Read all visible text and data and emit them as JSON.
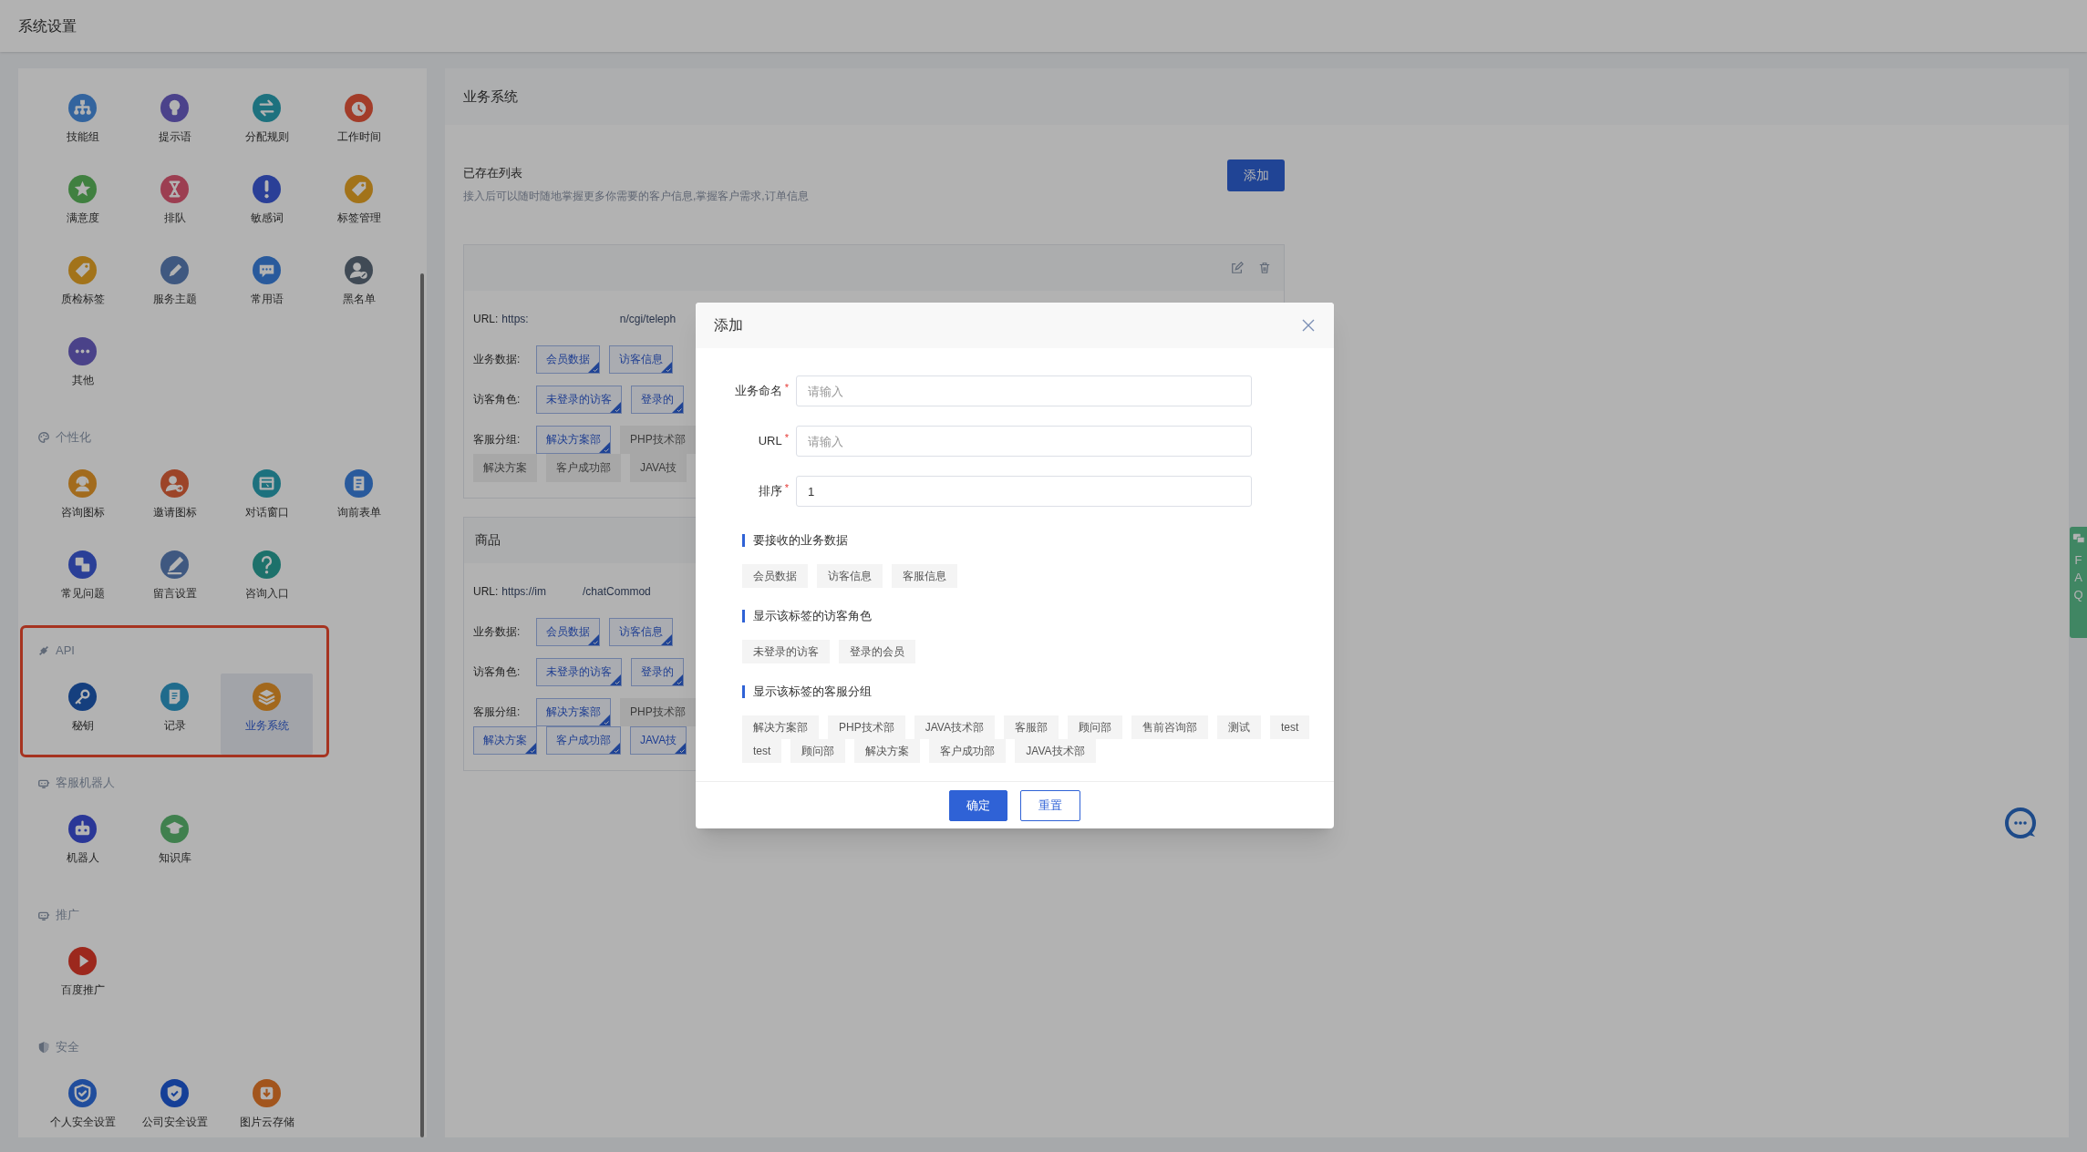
{
  "page_title": "系统设置",
  "settings_panel": {
    "sections": [
      {
        "items": [
          {
            "label": "技能组",
            "selected": false
          },
          {
            "label": "提示语",
            "selected": false
          },
          {
            "label": "分配规则",
            "selected": false
          },
          {
            "label": "工作时间",
            "selected": false
          },
          {
            "label": "满意度",
            "selected": false
          },
          {
            "label": "排队",
            "selected": false
          },
          {
            "label": "敏感词",
            "selected": false
          },
          {
            "label": "标签管理",
            "selected": false
          },
          {
            "label": "质检标签",
            "selected": false
          },
          {
            "label": "服务主题",
            "selected": false
          },
          {
            "label": "常用语",
            "selected": false
          },
          {
            "label": "黑名单",
            "selected": false
          },
          {
            "label": "其他",
            "selected": false
          }
        ]
      },
      {
        "title": "个性化",
        "items": [
          {
            "label": "咨询图标",
            "selected": false
          },
          {
            "label": "邀请图标",
            "selected": false
          },
          {
            "label": "对话窗口",
            "selected": false
          },
          {
            "label": "询前表单",
            "selected": false
          },
          {
            "label": "常见问题",
            "selected": false
          },
          {
            "label": "留言设置",
            "selected": false
          },
          {
            "label": "咨询入口",
            "selected": false
          }
        ]
      },
      {
        "title": "API",
        "highlighted": true,
        "items": [
          {
            "label": "秘钥",
            "selected": false
          },
          {
            "label": "记录",
            "selected": false
          },
          {
            "label": "业务系统",
            "selected": true
          }
        ]
      },
      {
        "title": "客服机器人",
        "items": [
          {
            "label": "机器人",
            "selected": false
          },
          {
            "label": "知识库",
            "selected": false
          }
        ]
      },
      {
        "title": "推广",
        "items": [
          {
            "label": "百度推广",
            "selected": false
          }
        ]
      },
      {
        "title": "安全",
        "items": [
          {
            "label": "个人安全设置",
            "selected": false
          },
          {
            "label": "公司安全设置",
            "selected": false
          },
          {
            "label": "图片云存储",
            "selected": false
          }
        ]
      }
    ]
  },
  "business_panel": {
    "title": "业务系统",
    "list_title": "已存在列表",
    "list_hint": "接入后可以随时随地掌握更多你需要的客户信息,掌握客户需求,订单信息",
    "add_button": "添加",
    "cards": [
      {
        "url_label": "URL:",
        "url_start": "https:",
        "url_end": "n/cgi/teleph",
        "rows": [
          {
            "label": "业务数据:",
            "tags": [
              {
                "text": "会员数据",
                "selected": true
              },
              {
                "text": "访客信息",
                "selected": true
              }
            ]
          },
          {
            "label": "访客角色:",
            "tags": [
              {
                "text": "未登录的访客",
                "selected": true
              },
              {
                "text": "登录的",
                "selected": true
              }
            ]
          },
          {
            "label": "客服分组:",
            "tags": [
              {
                "text": "解决方案部",
                "selected": true
              },
              {
                "text": "PHP技术部",
                "selected": false
              },
              {
                "text": "解决方案",
                "selected": false
              },
              {
                "text": "客户成功部",
                "selected": false
              },
              {
                "text": "JAVA技",
                "selected": false
              }
            ]
          }
        ]
      },
      {
        "title": "商品",
        "url_label": "URL:",
        "url_start": "https://im",
        "url_end": "/chatCommod",
        "rows": [
          {
            "label": "业务数据:",
            "tags": [
              {
                "text": "会员数据",
                "selected": true
              },
              {
                "text": "访客信息",
                "selected": true
              }
            ]
          },
          {
            "label": "访客角色:",
            "tags": [
              {
                "text": "未登录的访客",
                "selected": true
              },
              {
                "text": "登录的",
                "selected": true
              }
            ]
          },
          {
            "label": "客服分组:",
            "tags": [
              {
                "text": "解决方案部",
                "selected": true
              },
              {
                "text": "PHP技术部",
                "selected": false
              },
              {
                "text": "解决方案",
                "selected": true
              },
              {
                "text": "客户成功部",
                "selected": true
              },
              {
                "text": "JAVA技",
                "selected": true
              }
            ]
          }
        ]
      }
    ]
  },
  "modal": {
    "title": "添加",
    "fields": [
      {
        "label": "业务命名",
        "required_mark": "*",
        "placeholder": "请输入"
      },
      {
        "label": "URL",
        "required_mark": "*",
        "placeholder": "请输入"
      },
      {
        "label": "排序",
        "required_mark": "*",
        "value": "1"
      }
    ],
    "sections": [
      {
        "title": "要接收的业务数据",
        "tags": [
          {
            "text": "会员数据",
            "selected": false
          },
          {
            "text": "访客信息",
            "selected": false
          },
          {
            "text": "客服信息",
            "selected": false
          }
        ]
      },
      {
        "title": "显示该标签的访客角色",
        "tags": [
          {
            "text": "未登录的访客",
            "selected": false
          },
          {
            "text": "登录的会员",
            "selected": false
          }
        ]
      },
      {
        "title": "显示该标签的客服分组",
        "tags": [
          {
            "text": "解决方案部",
            "selected": false
          },
          {
            "text": "PHP技术部",
            "selected": false
          },
          {
            "text": "JAVA技术部",
            "selected": false
          },
          {
            "text": "客服部",
            "selected": false
          },
          {
            "text": "顾问部",
            "selected": false
          },
          {
            "text": "售前咨询部",
            "selected": false
          },
          {
            "text": "测试",
            "selected": false
          },
          {
            "text": "test",
            "selected": false
          },
          {
            "text": "test",
            "selected": false
          },
          {
            "text": "顾问部",
            "selected": false
          },
          {
            "text": "解决方案",
            "selected": false
          },
          {
            "text": "客户成功部",
            "selected": false
          },
          {
            "text": "JAVA技术部",
            "selected": false
          }
        ]
      }
    ],
    "buttons": [
      {
        "label": "确定",
        "kind": "primary"
      },
      {
        "label": "重置",
        "kind": "secondary"
      }
    ]
  },
  "faq_tab": {
    "text": "FAQ"
  }
}
